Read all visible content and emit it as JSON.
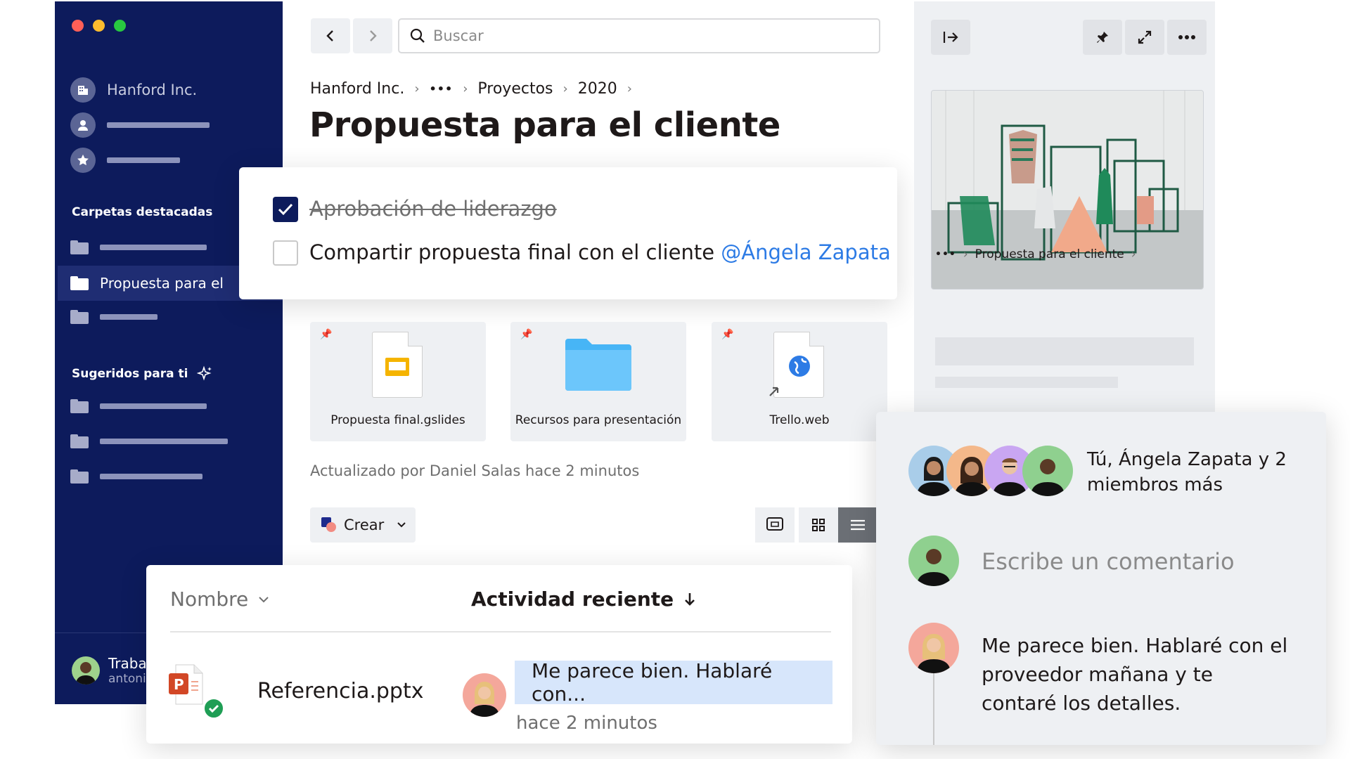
{
  "sidebar": {
    "org": "Hanford Inc.",
    "featured_heading": "Carpetas destacadas",
    "active_folder": "Propuesta para el",
    "suggested_heading": "Sugeridos para ti",
    "user_name": "Traba",
    "user_email": "antoni"
  },
  "search": {
    "placeholder": "Buscar"
  },
  "breadcrumb": {
    "org": "Hanford Inc.",
    "ellipsis": "•••",
    "projects": "Proyectos",
    "year": "2020"
  },
  "page": {
    "title": "Propuesta para el cliente"
  },
  "checklist": {
    "task1": "Aprobación de liderazgo",
    "task2": "Compartir propuesta final con el cliente",
    "mention": "@Ángela Zapata"
  },
  "cards": [
    {
      "label": "Propuesta final.gslides",
      "icon": "slides-icon"
    },
    {
      "label": "Recursos para presentación",
      "icon": "folder-icon"
    },
    {
      "label": "Trello.web",
      "icon": "web-link-icon"
    }
  ],
  "updated": "Actualizado por Daniel Salas hace 2 minutos",
  "create_label": "Crear",
  "file_table": {
    "col_name": "Nombre",
    "col_activity": "Actividad reciente",
    "file_name": "Referencia.pptx",
    "activity_text": "Me parece bien. Hablaré con...",
    "activity_time": "hace 2 minutos"
  },
  "right_panel": {
    "breadcrumb_ellipsis": "•••",
    "breadcrumb_folder": "Propuesta para el cliente"
  },
  "comments": {
    "members": "Tú, Ángela Zapata y 2 miembros más",
    "placeholder": "Escribe un comentario",
    "comment_text": "Me parece bien. Hablaré con el proveedor mañana y te contaré los detalles."
  },
  "colors": {
    "sidebar_bg": "#0d1b5c",
    "mention": "#2d7be5",
    "panel_bg": "#eef0f3"
  }
}
